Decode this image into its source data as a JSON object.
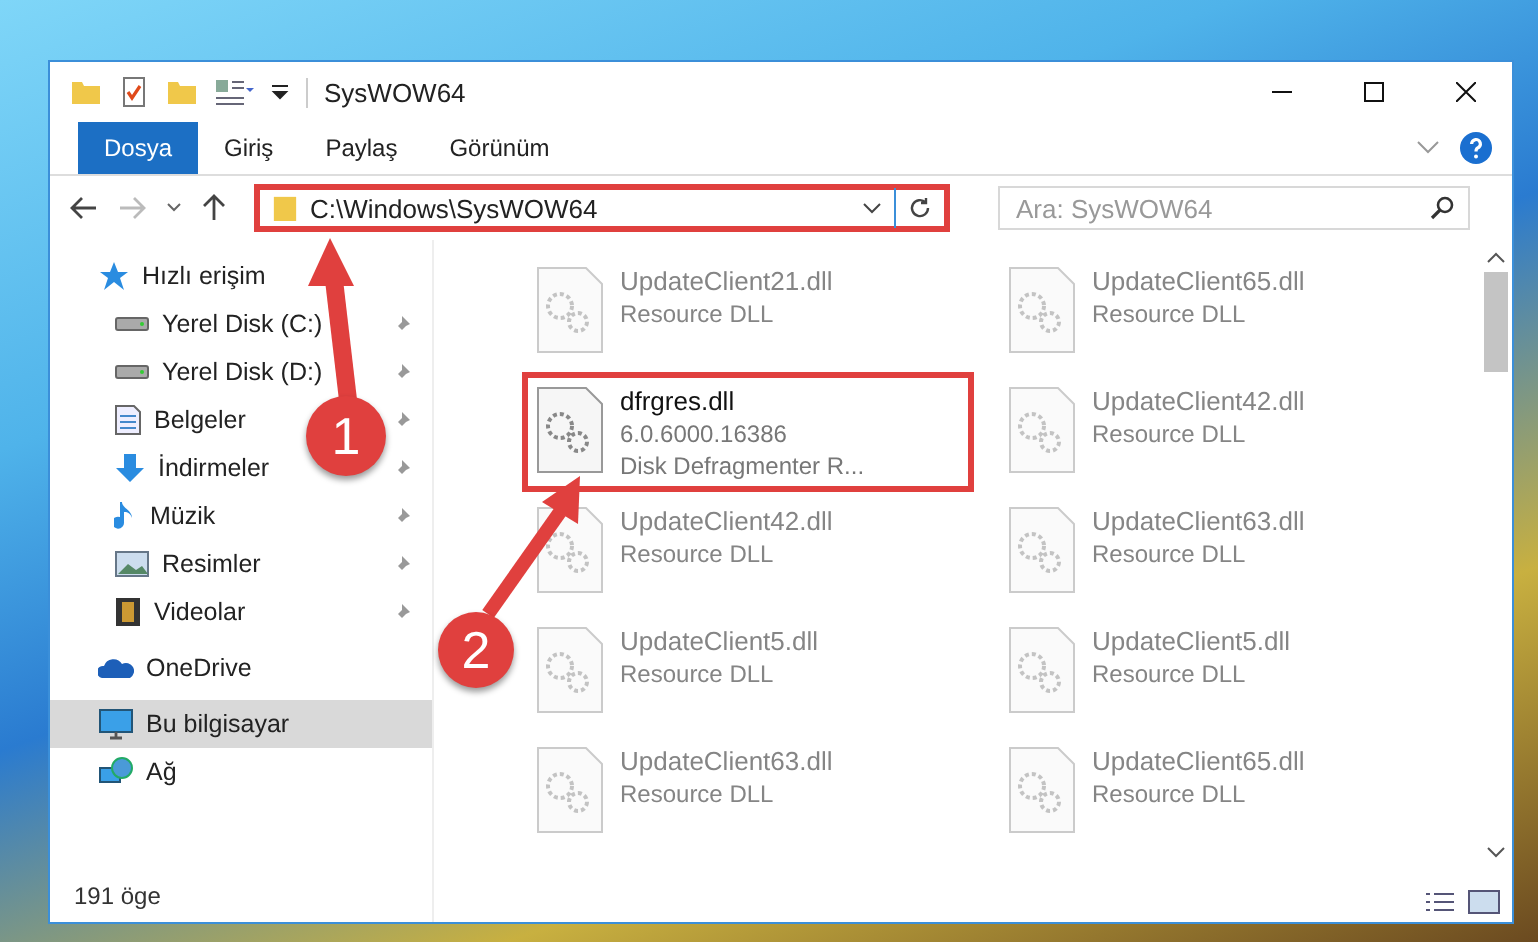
{
  "window": {
    "title": "SysWOW64"
  },
  "ribbon_tabs": [
    {
      "label": "Dosya",
      "selected": true
    },
    {
      "label": "Giriş",
      "selected": false
    },
    {
      "label": "Paylaş",
      "selected": false
    },
    {
      "label": "Görünüm",
      "selected": false
    }
  ],
  "address": {
    "path": "C:\\Windows\\SysWOW64",
    "highlighted": true
  },
  "search": {
    "placeholder": "Ara: SysWOW64"
  },
  "sidebar": {
    "items": [
      {
        "label": "Hızlı erişim",
        "kind": "star",
        "selected": false,
        "children": [
          {
            "label": "Yerel Disk (C:)",
            "kind": "drive",
            "pinned": true,
            "selected": false
          },
          {
            "label": "Yerel Disk (D:)",
            "kind": "drive",
            "pinned": true,
            "selected": false
          },
          {
            "label": "Belgeler",
            "kind": "documents",
            "pinned": true,
            "selected": false
          },
          {
            "label": "İndirmeler",
            "kind": "download",
            "pinned": true,
            "selected": false
          },
          {
            "label": "Müzik",
            "kind": "music",
            "pinned": true,
            "selected": false
          },
          {
            "label": "Resimler",
            "kind": "pictures",
            "pinned": true,
            "selected": false
          },
          {
            "label": "Videolar",
            "kind": "videos",
            "pinned": true,
            "selected": false
          }
        ]
      },
      {
        "label": "OneDrive",
        "kind": "cloud",
        "selected": false
      },
      {
        "label": "Bu bilgisayar",
        "kind": "computer",
        "selected": true
      },
      {
        "label": "Ağ",
        "kind": "network",
        "selected": false
      }
    ]
  },
  "files": [
    {
      "name": "UpdateClient21.dll",
      "lines": [
        "Resource DLL"
      ],
      "dimmed": true,
      "highlighted": false
    },
    {
      "name": "UpdateClient65.dll",
      "lines": [
        "Resource DLL"
      ],
      "dimmed": true,
      "highlighted": false
    },
    {
      "name": "dfrgres.dll",
      "lines": [
        "6.0.6000.16386",
        "Disk Defragmenter R..."
      ],
      "dimmed": false,
      "highlighted": true
    },
    {
      "name": "UpdateClient42.dll",
      "lines": [
        "Resource DLL"
      ],
      "dimmed": true,
      "highlighted": false
    },
    {
      "name": "UpdateClient42.dll",
      "lines": [
        "Resource DLL"
      ],
      "dimmed": true,
      "highlighted": false
    },
    {
      "name": "UpdateClient63.dll",
      "lines": [
        "Resource DLL"
      ],
      "dimmed": true,
      "highlighted": false
    },
    {
      "name": "UpdateClient5.dll",
      "lines": [
        "Resource DLL"
      ],
      "dimmed": true,
      "highlighted": false
    },
    {
      "name": "UpdateClient5.dll",
      "lines": [
        "Resource DLL"
      ],
      "dimmed": true,
      "highlighted": false
    },
    {
      "name": "UpdateClient63.dll",
      "lines": [
        "Resource DLL"
      ],
      "dimmed": true,
      "highlighted": false
    },
    {
      "name": "UpdateClient65.dll",
      "lines": [
        "Resource DLL"
      ],
      "dimmed": true,
      "highlighted": false
    }
  ],
  "annotations": [
    {
      "number": "1"
    },
    {
      "number": "2"
    }
  ],
  "status_bar": {
    "count": "191 öge"
  }
}
